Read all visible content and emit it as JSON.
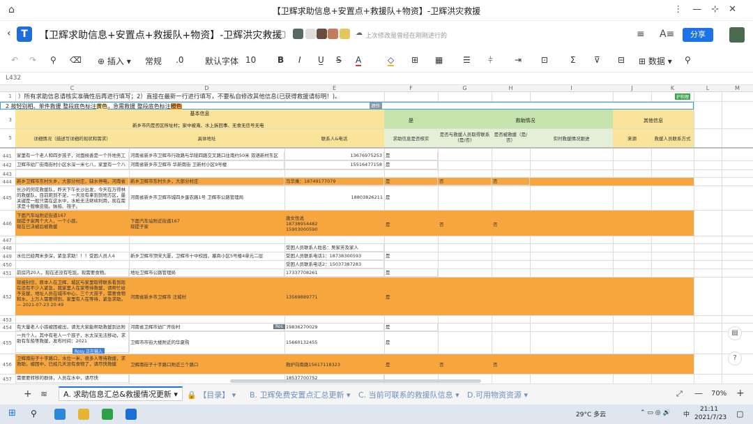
{
  "window": {
    "title": "【卫辉求助信息+安置点+救援队+物资】-卫辉洪灾救援"
  },
  "doc": {
    "title": "【卫辉求助信息+安置点+救援队+物资】-卫辉洪灾救援",
    "save_status": "上次修改是曾经在刚刚进行的",
    "share": "分享"
  },
  "toolbar": {
    "insert": "插入",
    "normal": "常规",
    "dec": ".0",
    "font": "默认字体",
    "size": "10",
    "bold": "B",
    "italic": "I",
    "strike": "S",
    "color_a": "A",
    "data": "数据"
  },
  "namebox": "L432",
  "columns": [
    "C",
    "D",
    "E",
    "F",
    "G",
    "H",
    "I",
    "J",
    "K",
    "L",
    "M"
  ],
  "notes": {
    "row1": "）所有求助信息请核实准确性后再进行填写；2）直接在最新一行进行填写，不要私自修改其他信息(已获得救援请标明！)。",
    "row2_a": "2 按轻别相、单件救援 整段底色标注",
    "row2_b": "黄色",
    "row2_c": "，急需救援 整段底色标注",
    "row2_d": "橙色",
    "row2_tag": "护和理",
    "row2_tag2": "跨作"
  },
  "header": {
    "basic": "基本信息",
    "basic_sub": "新乡市内是否区所址村；家中被淹、水上拆回事、无食无信号无电",
    "detail": "详细情况（描述写详细的现状和需求）",
    "addr": "具体地址",
    "contact": "联系人&电话",
    "is": "是",
    "verified": "求助信息是否核实",
    "rescue": "救助情况",
    "rescue_cols": [
      "是否与救援人员取得联系(是/否)",
      "是否被救援（是/否）",
      "实时救援情况跟进"
    ],
    "other": "其他信息",
    "other_cols": [
      "来源",
      "救援人员联系方式"
    ]
  },
  "rows": [
    {
      "n": "441",
      "detail": "家里有一个老人和四岁孩子，对面候善是一个外地务工",
      "addr": "河南省新乡市卫辉市行政路与华陵四路交叉路口往南约50米 双语新村东区",
      "contact": "13676975253",
      "f": "是",
      "g": "",
      "h": ""
    },
    {
      "n": "442",
      "detail": "卫辉市幼厂街南街村小区水深一米七八，家里有一个八",
      "addr": "河南省新乡市卫辉市 华新南街 卫新村小区9号楼",
      "contact": "15516477158",
      "f": "是",
      "g": "",
      "h": ""
    },
    {
      "n": "443",
      "detail": "",
      "addr": "",
      "contact": "",
      "f": "",
      "g": "",
      "h": ""
    },
    {
      "n": "444",
      "detail": "新乡卫辉市东村头乡，大部分村庄，缺水停电，河南省新乡卫辉市东村头乡，大部分村庄",
      "addr": "新乡卫辉市东村头乡，大部分村庄",
      "contact": "马华乘：18749177079",
      "f": "是",
      "g": "否",
      "h": "否"
    },
    {
      "n": "445",
      "detail": "长沙的何花救援队，昨天下午长沙出发，今天在万得林的救援队，目前距到不足，一天没有拿到到地方区，最关键是一般只需在这水中，水枪无法继续利用，现在需求是十艘橡皮艇。脉船、筏子。",
      "addr": "河南省新乡市卫辉市城四乡蛋农路1号 卫辉市公路管理局",
      "contact": "18803826211",
      "f": "是",
      "g": "",
      "h": ""
    },
    {
      "n": "446",
      "detail": "下面汽车站附近街道167\n现提子家两个大人，一个小孩。\n现在已决被后被救援",
      "addr": "下面汽车站附近街道167\n现提子家",
      "contact": "唐女性说\n18738954482\n15903000590",
      "f": "是",
      "g": "否",
      "h": "否"
    },
    {
      "n": "447",
      "detail": "",
      "addr": "",
      "contact": "",
      "f": "",
      "g": "",
      "h": ""
    },
    {
      "n": "448",
      "detail": "",
      "addr": "",
      "contact": "受困人员联系人姓名：吴家芳及家人",
      "f": "",
      "g": "",
      "h": ""
    },
    {
      "n": "449",
      "detail": "水位已经两米多深，紧急求助！！！受困人员人4",
      "addr": "新乡卫辉市顶宋大厦，卫辉市十中校园，塞商小区5号楼4单元二层",
      "contact": "受困人员联系电话1：18738300593",
      "f": "是",
      "g": "",
      "h": ""
    },
    {
      "n": "450",
      "detail": "",
      "addr": "",
      "contact": "受困人员联系电话2：15037387283",
      "f": "",
      "g": "",
      "h": ""
    },
    {
      "n": "451",
      "detail": "前房内20人，现在还没有吃饭，现需要食物。",
      "addr": "地址卫辉市公路管理局",
      "contact": "17337708261",
      "f": "是",
      "g": "",
      "h": ""
    },
    {
      "n": "452",
      "detail": "现被封信，原本人在卫辉，城区与家里取得联系看到现在还有不少人紧急，我家里人在家等待救援，请帮忙给予支援，地址人员在城市中心，三个大孩子，需要食物和水，上万人需要得到，家里有人在等待，紧急求助。— 2021-07-23 20:49",
      "addr": "河南省新乡市卫辉市 汪城村",
      "contact": "13569889771",
      "f": "是",
      "g": "",
      "h": ""
    },
    {
      "n": "453",
      "detail": "",
      "addr": "",
      "contact": "",
      "f": "",
      "g": "",
      "h": ""
    },
    {
      "n": "454",
      "detail": "有大量老人小孩被困被出，请无大家能帮助救援到达附近",
      "addr": "河南省卫辉市幼厂开街村",
      "contact": "19836270029",
      "f": "是",
      "g": "",
      "h": ""
    },
    {
      "n": "455",
      "detail": "一共个人，其中有老人一个孩子，水太深无法移动，求助有车船等救援，发布时间：2021",
      "addr": "卫辉市市街大楼附近的华夏购",
      "contact": "15660132455",
      "f": "是",
      "g": "",
      "h": ""
    },
    {
      "n": "456",
      "detail": "卫辉南街子十字路口，水位一米，很多人等待救援，求救助，被困中，已经几天没有食物了，请尽快救援",
      "addr": "卫辉南街子十字路口附近三个路口",
      "contact": "救护向南路15617118323",
      "f": "是",
      "g": "否",
      "h": "否"
    },
    {
      "n": "457",
      "detail": "需要要转移的群体，人员在水中，请尽快",
      "addr": "",
      "contact": "18537700752",
      "f": "",
      "g": "",
      "h": ""
    }
  ],
  "sheets": [
    "A. 求助信息汇总&救援情况更新",
    "【目录】",
    "B. 卫辉免费安置点汇总更新",
    "C. 当前可联系的救援队信息",
    "D.可用物资资源"
  ],
  "zoom": "70%",
  "taskbar": {
    "weather": "29°C 多云",
    "ime": "中",
    "time": "21:11",
    "date": "2021/7/23"
  },
  "tags": {
    "lbl_a": "Ros",
    "lbl_b": "Rosy 正在输入"
  }
}
